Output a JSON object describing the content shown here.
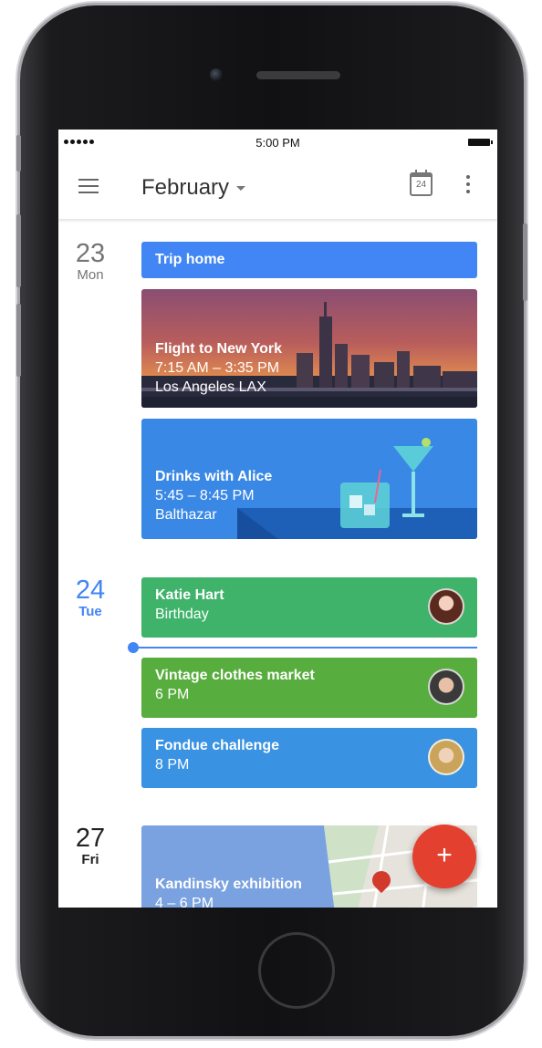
{
  "status_bar": {
    "time": "5:00 PM"
  },
  "app_bar": {
    "month": "February",
    "today_date": "24"
  },
  "days": [
    {
      "number": "23",
      "name": "Mon"
    },
    {
      "number": "24",
      "name": "Tue"
    },
    {
      "number": "27",
      "name": "Fri"
    }
  ],
  "events": [
    {
      "title": "Trip home",
      "color": "#4285f4"
    },
    {
      "title": "Flight to New York",
      "time": "7:15 AM – 3:35 PM",
      "location": "Los Angeles LAX"
    },
    {
      "title": "Drinks with Alice",
      "time": "5:45 – 8:45 PM",
      "location": "Balthazar",
      "color": "#3a88e6"
    },
    {
      "title": "Katie Hart",
      "subtitle": "Birthday",
      "color": "#3fb36a"
    },
    {
      "title": "Vintage clothes market",
      "time": "6 PM",
      "color": "#57ad3d"
    },
    {
      "title": "Fondue challenge",
      "time": "8 PM",
      "color": "#3a92e2"
    },
    {
      "title": "Kandinsky exhibition",
      "time": "4 – 6 PM"
    }
  ],
  "fab": {
    "label": "+"
  },
  "colors": {
    "accent": "#4285f4",
    "fab": "#e4402f"
  },
  "icons": [
    "menu-icon",
    "today-calendar-icon",
    "more-vert-icon",
    "map-pin-icon"
  ]
}
